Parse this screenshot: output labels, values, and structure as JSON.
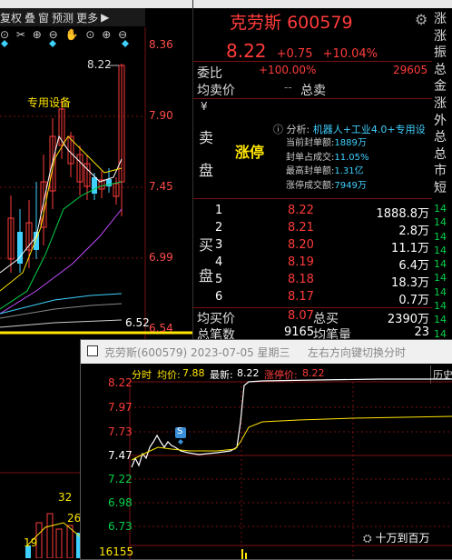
{
  "left": {
    "toolbar": [
      "复权",
      "叠",
      "窗",
      "预测",
      "更多"
    ],
    "toolbar_arrow": "▶",
    "icons": [
      "⊙",
      "✂",
      "⊕",
      "⊖",
      "✋",
      "⊙",
      "⊕",
      "⊖"
    ],
    "price_top": "8.22",
    "annotation": "专用设备",
    "yaxis": [
      "8.36",
      "7.90",
      "7.45",
      "6.99",
      "6.54"
    ],
    "low_label": "6.52",
    "vol_labels": [
      "32",
      "26",
      "19"
    ]
  },
  "quote": {
    "name": "克劳斯",
    "code": "600579",
    "price": "8.22",
    "change": "+0.75",
    "pct": "+10.04%",
    "weibi_label": "委比",
    "weibi_value": "+100.00%",
    "weicha_value": "29605",
    "jun_label": "均卖价",
    "zongmai_label": "总卖",
    "sell_chars": [
      "¥",
      "卖",
      "盘"
    ],
    "limit_up": "涨停",
    "analysis_label": "分析:",
    "analysis_value": "机器人+工业4.0+专用设",
    "info": [
      {
        "label": "当前封单额:",
        "value": "1889万"
      },
      {
        "label": "封单占成交:",
        "value": "11.05%"
      },
      {
        "label": "最高封单额:",
        "value": "1.31亿"
      },
      {
        "label": "涨停成交额:",
        "value": "7949万"
      }
    ],
    "buy_chars": [
      "买",
      "盘"
    ],
    "bids": [
      {
        "level": "1",
        "price": "8.22",
        "vol": "1888.8万"
      },
      {
        "level": "2",
        "price": "8.21",
        "vol": "2.8万"
      },
      {
        "level": "3",
        "price": "8.20",
        "vol": "11.1万"
      },
      {
        "level": "4",
        "price": "8.19",
        "vol": "6.4万"
      },
      {
        "level": "5",
        "price": "8.18",
        "vol": "18.3万"
      },
      {
        "level": "6",
        "price": "8.17",
        "vol": "0.7万"
      }
    ],
    "avg_buy_label": "均买价",
    "avg_buy_value": "8.07",
    "total_buy_label": "总买",
    "total_buy_value": "2390万",
    "deal_label": "总笔数",
    "deal_value": "9165",
    "avg_deal_label": "均笔量",
    "avg_deal_value": "23"
  },
  "side": [
    "涨",
    "涨",
    "振",
    "总",
    "金",
    "涨",
    "外",
    "总",
    "总",
    "市",
    "短",
    "14",
    "14",
    "14",
    "14",
    "14",
    "14",
    "14",
    "14",
    "14",
    "14",
    "14"
  ],
  "tick": {
    "title": "克劳斯(600579) 2023-07-05 星期三",
    "hint": "左右方向键切换分时",
    "info_prefix": "分时",
    "avg_label": "均价:",
    "avg_value": "7.88",
    "last_label": "最新:",
    "last_value": "8.22",
    "limit_label": "涨停价:",
    "limit_value": "8.22",
    "history_label": "历史",
    "yaxis": [
      "8.22",
      "7.97",
      "7.73",
      "7.47",
      "7.22",
      "6.98",
      "6.73"
    ],
    "vol_label": "16155",
    "s_badge": "S"
  },
  "watermark": "十万到百万"
}
